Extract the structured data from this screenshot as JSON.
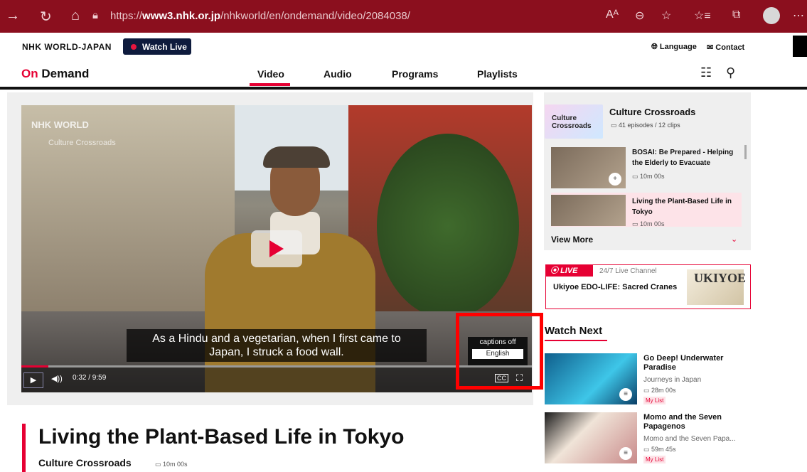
{
  "browser": {
    "url_prefix": "https://",
    "url_domain": "www3.nhk.or.jp",
    "url_path": "/nhkworld/en/ondemand/video/2084038/"
  },
  "topbar": {
    "logo": "NHK WORLD-JAPAN",
    "watch_live": "Watch Live",
    "language": "Language",
    "contact": "Contact"
  },
  "ondemand": {
    "logo_on": "On",
    "logo_rest": " Demand",
    "nav": [
      "Video",
      "Audio",
      "Programs",
      "Playlists"
    ]
  },
  "player": {
    "watermark": "NHK WORLD",
    "watermark_sub": "Culture Crossroads",
    "caption_line1": "As a Hindu and a vegetarian, when I first came to",
    "caption_line2": "Japan, I struck a food wall.",
    "time": "0:32 / 9:59",
    "progress": 0.053,
    "cc_off": "captions off",
    "cc_english": "English",
    "cc_label": "CC"
  },
  "series": {
    "thumb_label": "Culture Crossroads",
    "title": "Culture Crossroads",
    "meta": "41 episodes  /  12 clips",
    "episodes": [
      {
        "title": "BOSAI: Be Prepared - Helping the Elderly to Evacuate",
        "duration": "10m 00s"
      },
      {
        "title": "Living the Plant-Based Life in Tokyo",
        "duration": "10m 00s"
      }
    ],
    "view_more": "View More"
  },
  "live": {
    "tag": "LIVE",
    "channel": "24/7 Live Channel",
    "title": "Ukiyoe EDO-LIFE: Sacred Cranes",
    "thumb_text": "UKIYOE"
  },
  "watch_next": {
    "heading": "Watch Next",
    "items": [
      {
        "title": "Go Deep! Underwater Paradise",
        "series": "Journeys in Japan",
        "duration": "28m 00s",
        "mylist": "My List"
      },
      {
        "title": "Momo and the Seven Papagenos",
        "series": "Momo and the Seven Papa...",
        "duration": "59m 45s",
        "mylist": "My List"
      }
    ]
  },
  "episode": {
    "title": "Living the Plant-Based Life in Tokyo",
    "series": "Culture Crossroads",
    "duration": "10m 00s"
  },
  "colors": {
    "browser_chrome": "#8b0f1e",
    "accent": "#e60033",
    "navy": "#0e1b3d"
  }
}
